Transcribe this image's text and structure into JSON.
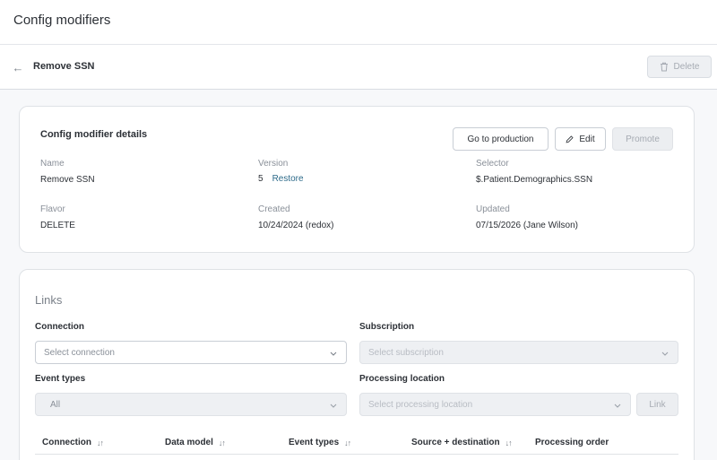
{
  "app": {
    "title": "Config modifiers"
  },
  "header": {
    "title": "Remove SSN",
    "delete_label": "Delete"
  },
  "details": {
    "title": "Config modifier details",
    "buttons": {
      "go_to_production": "Go to production",
      "edit": "Edit",
      "promote": "Promote"
    },
    "fields": {
      "name": {
        "label": "Name",
        "value": "Remove SSN"
      },
      "version": {
        "label": "Version",
        "value": "5",
        "restore_label": "Restore"
      },
      "selector": {
        "label": "Selector",
        "value": "$.Patient.Demographics.SSN"
      },
      "flavor": {
        "label": "Flavor",
        "value": "DELETE"
      },
      "created": {
        "label": "Created",
        "value": "10/24/2024 (redox)"
      },
      "updated": {
        "label": "Updated",
        "value": "07/15/2026 (Jane Wilson)"
      }
    }
  },
  "links": {
    "title": "Links",
    "connection": {
      "label": "Connection",
      "placeholder": "Select connection"
    },
    "subscription": {
      "label": "Subscription",
      "placeholder": "Select subscription"
    },
    "event_types": {
      "label": "Event types",
      "value": "All"
    },
    "processing_location": {
      "label": "Processing location",
      "placeholder": "Select processing location"
    },
    "link_label": "Link",
    "table": {
      "columns": [
        "Connection",
        "Data model",
        "Event types",
        "Source + destination",
        "Processing order"
      ]
    }
  },
  "icons": {
    "back": "arrow-left-icon",
    "trash": "trash-icon",
    "pencil": "pencil-icon",
    "chevron": "chevron-down-icon",
    "sort": "sort-icon"
  }
}
